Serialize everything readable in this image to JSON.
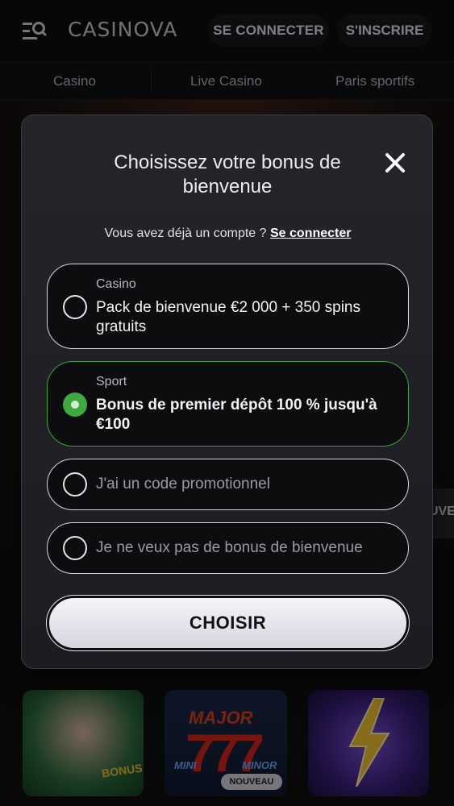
{
  "header": {
    "logo": "CASINOVA",
    "login_label": "SE CONNECTER",
    "register_label": "S'INSCRIRE",
    "icons": {
      "menu": "menu-search-icon"
    }
  },
  "nav": {
    "items": [
      {
        "label": "Casino"
      },
      {
        "label": "Live Casino"
      },
      {
        "label": "Paris sportifs"
      }
    ]
  },
  "background": {
    "edge_tab_label": "UVE",
    "tiles": [
      {
        "badge_text": "BONUS"
      },
      {
        "title_text": "MAJOR",
        "mini_text": "MINI",
        "minor_text": "MINOR",
        "badge": "NOUVEAU"
      },
      {
        "icon": "lightning-bolt-icon"
      }
    ]
  },
  "modal": {
    "title": "Choisissez votre bonus de bienvenue",
    "account_prompt": "Vous avez déjà un compte ?",
    "account_link": "Se connecter",
    "options": [
      {
        "category": "Casino",
        "text": "Pack de bienvenue €2 000 + 350 spins gratuits",
        "selected": false
      },
      {
        "category": "Sport",
        "text": "Bonus de premier dépôt 100 % jusqu'à €100",
        "selected": true
      },
      {
        "text": "J'ai un code promotionnel",
        "selected": false
      },
      {
        "text": "Je ne veux pas de bonus de bienvenue",
        "selected": false
      }
    ],
    "submit_label": "CHOISIR"
  },
  "colors": {
    "selected_accent": "#3da93f",
    "modal_bg": "#1f1f24",
    "button_bg": "#eeeef3"
  }
}
